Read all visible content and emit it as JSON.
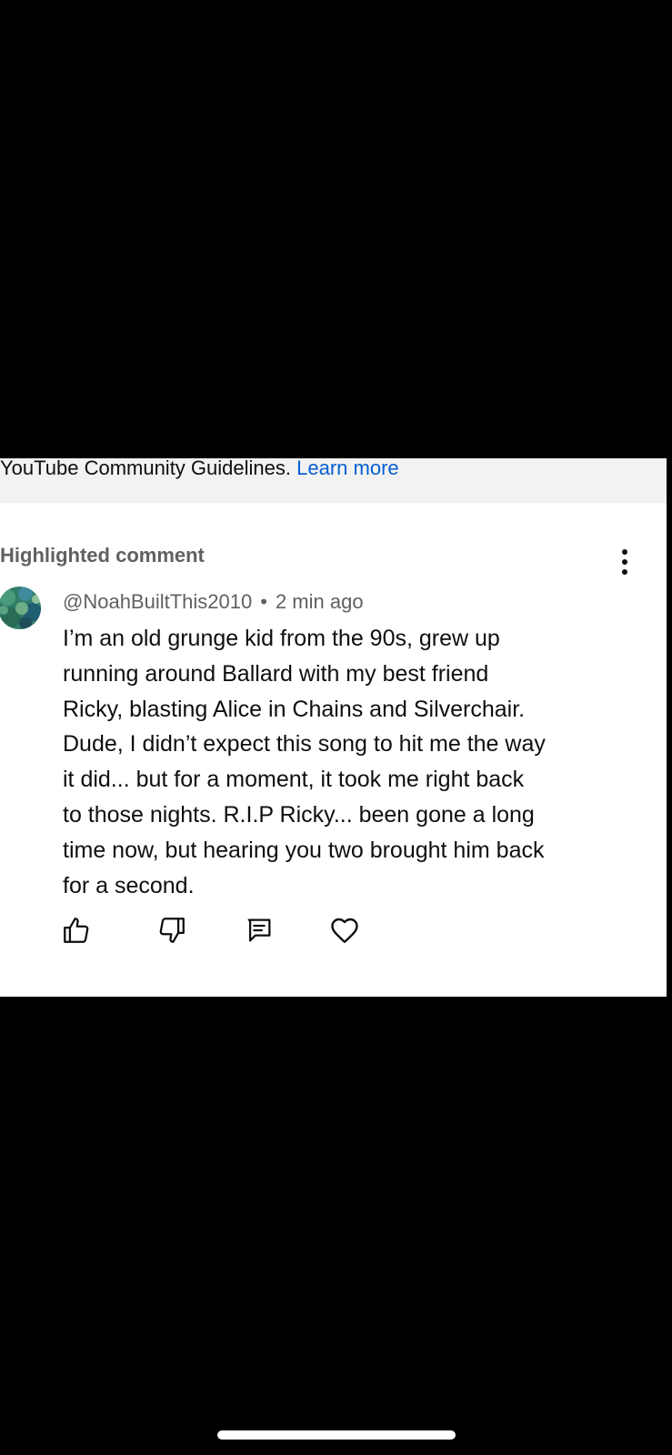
{
  "notice": {
    "text": "YouTube Community Guidelines.",
    "link_label": "Learn more"
  },
  "comment": {
    "section_label": "Highlighted comment",
    "author": "@NoahBuiltThis2010",
    "separator": "•",
    "timestamp": "2 min ago",
    "body": "I’m an old grunge kid from the 90s, grew up\nrunning around Ballard with my best friend\nRicky, blasting Alice in Chains and Silverchair.\nDude, I didn’t expect this song to hit me the way\nit did... but for a moment, it took me right back\nto those nights. R.I.P Ricky... been gone a long\ntime now, but hearing you two brought him back\nfor a second."
  },
  "icons": {
    "more": "more-vertical-icon",
    "like": "thumbs-up-icon",
    "dislike": "thumbs-down-icon",
    "reply": "reply-comment-icon",
    "heart": "heart-icon"
  },
  "colors": {
    "link": "#065fd4",
    "meta_text": "#606060",
    "body_text": "#0f0f0f",
    "notice_background": "#f2f2f2"
  }
}
